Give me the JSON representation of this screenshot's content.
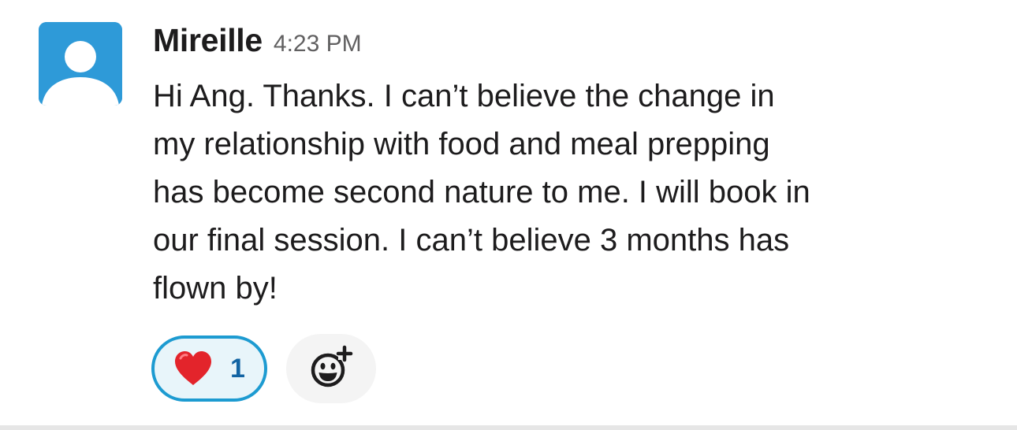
{
  "message": {
    "sender": "Mireille",
    "timestamp": "4:23 PM",
    "text": "Hi Ang. Thanks. I can’t believe the change in\nmy relationship with food and meal prepping\nhas become second nature to me. I will book in\nour final session. I can’t believe 3 months has\nflown by!",
    "avatar_icon": "default-user-avatar-icon",
    "avatar_color": "#2e9ad8"
  },
  "reactions": [
    {
      "emoji_icon": "red-heart-icon",
      "count": "1",
      "selected": true,
      "accent": "#1d9bd1"
    }
  ],
  "add_reaction": {
    "icon": "add-reaction-smiley-icon"
  }
}
